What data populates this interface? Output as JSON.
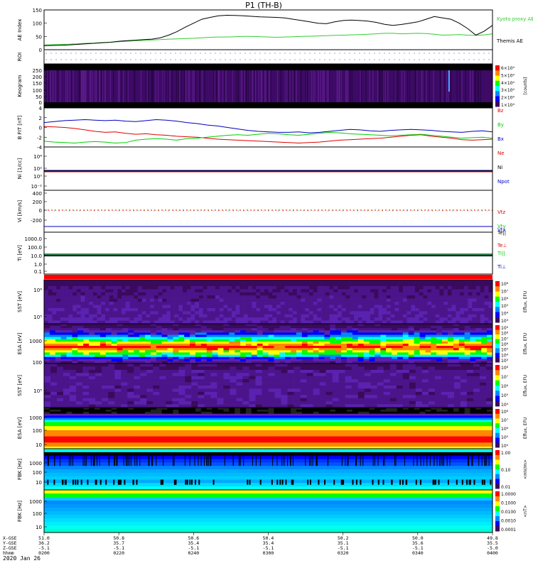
{
  "title": "P1 (TH-B)",
  "date_label": "2020 Jan 26",
  "colors": {
    "black": "#000000",
    "red": "#e00000",
    "green": "#00d000",
    "blue": "#0000c0",
    "kyoto": "#33cc33",
    "spec_bg": "#3a0a5c"
  },
  "chart_data": [
    {
      "id": "ae",
      "type": "line",
      "ylabel": "AE Index",
      "ylim": [
        0,
        150
      ],
      "yticks": [
        "0",
        "50",
        "100",
        "150"
      ],
      "series": [
        {
          "name": "Kyoto proxy AE",
          "color": "#33cc33",
          "values": [
            18,
            19,
            20,
            21,
            22,
            24,
            25,
            27,
            28,
            30,
            32,
            34,
            35,
            37,
            38,
            40,
            41,
            42,
            43,
            45,
            47,
            48,
            48,
            49,
            50,
            50,
            49,
            48,
            47,
            48,
            49,
            50,
            51,
            52,
            53,
            54,
            55,
            56,
            57,
            58,
            60,
            62,
            62,
            60,
            61,
            62,
            61,
            58,
            55,
            56,
            57,
            55,
            54,
            56,
            60
          ]
        },
        {
          "name": "Themis AE",
          "color": "#000000",
          "values": [
            15,
            16,
            17,
            18,
            20,
            22,
            24,
            26,
            28,
            32,
            34,
            36,
            38,
            40,
            45,
            55,
            68,
            85,
            100,
            115,
            122,
            128,
            130,
            129,
            128,
            126,
            124,
            123,
            122,
            120,
            115,
            110,
            105,
            100,
            98,
            105,
            110,
            112,
            110,
            108,
            103,
            96,
            92,
            95,
            100,
            105,
            115,
            125,
            120,
            115,
            100,
            80,
            55,
            70,
            92
          ]
        }
      ]
    },
    {
      "id": "roi",
      "type": "line",
      "ylabel": "ROI"
    },
    {
      "id": "keogram",
      "type": "heatmap",
      "ylabel": "Keogram",
      "yticks": [
        "0",
        "50",
        "100",
        "150",
        "200",
        "250"
      ],
      "colorbar": {
        "label": "[counts]",
        "ticks": [
          "6×10⁴",
          "5×10⁴",
          "4×10⁴",
          "3×10⁴",
          "2×10⁴",
          "1×10⁴"
        ]
      }
    },
    {
      "id": "bfield",
      "type": "line",
      "ylabel": "B FIT [nT]",
      "ylim": [
        -4,
        4
      ],
      "yticks": [
        "4",
        "2",
        "0",
        "-2",
        "-4"
      ],
      "series": [
        {
          "name": "Bz",
          "color": "#e00000",
          "values": [
            0.2,
            0.1,
            0.0,
            -0.2,
            -0.5,
            -0.8,
            -1.0,
            -0.9,
            -1.2,
            -1.4,
            -1.3,
            -1.5,
            -1.6,
            -1.8,
            -1.9,
            -2.0,
            -2.2,
            -2.4,
            -2.5,
            -2.6,
            -2.7,
            -2.8,
            -2.9,
            -3.0,
            -3.1,
            -3.2,
            -3.1,
            -3.0,
            -2.8,
            -2.6,
            -2.5,
            -2.4,
            -2.3,
            -2.2,
            -2.0,
            -1.8,
            -1.6,
            -1.5,
            -1.8,
            -2.0,
            -2.2,
            -2.5,
            -2.6,
            -2.5,
            -2.4
          ]
        },
        {
          "name": "By",
          "color": "#00d000",
          "values": [
            -2.8,
            -3.0,
            -3.1,
            -3.2,
            -3.0,
            -2.9,
            -3.0,
            -3.2,
            -3.1,
            -2.6,
            -2.4,
            -2.3,
            -2.4,
            -2.6,
            -2.3,
            -2.2,
            -2.0,
            -1.8,
            -1.6,
            -1.5,
            -1.6,
            -1.4,
            -1.2,
            -1.3,
            -1.5,
            -1.6,
            -1.4,
            -1.2,
            -1.0,
            -1.1,
            -1.3,
            -1.4,
            -1.5,
            -1.6,
            -1.7,
            -1.6,
            -1.5,
            -1.4,
            -1.6,
            -1.8,
            -2.0,
            -2.2,
            -2.1,
            -2.0,
            -2.2
          ]
        },
        {
          "name": "Bx",
          "color": "#0000c0",
          "values": [
            1.0,
            1.2,
            1.4,
            1.5,
            1.6,
            1.5,
            1.4,
            1.5,
            1.3,
            1.2,
            1.4,
            1.6,
            1.5,
            1.3,
            1.0,
            0.8,
            0.5,
            0.3,
            0.0,
            -0.3,
            -0.6,
            -0.8,
            -0.9,
            -1.0,
            -1.0,
            -0.9,
            -1.1,
            -1.0,
            -0.8,
            -0.6,
            -0.4,
            -0.5,
            -0.7,
            -0.8,
            -0.6,
            -0.5,
            -0.4,
            -0.5,
            -0.6,
            -0.8,
            -0.9,
            -1.0,
            -0.8,
            -0.7,
            -0.9
          ]
        }
      ]
    },
    {
      "id": "density",
      "type": "line",
      "ylabel": "Ni [1/cc]",
      "yticks": [
        "10⁴",
        "10²",
        "10⁰",
        "10⁻²"
      ],
      "series": [
        {
          "name": "Ne",
          "color": "#e00000"
        },
        {
          "name": "Ni",
          "color": "#000000"
        },
        {
          "name": "Npot",
          "color": "#0000c0"
        }
      ]
    },
    {
      "id": "velocity",
      "type": "line",
      "ylabel": "Vi [km/s]",
      "yticks": [
        "400",
        "200",
        "0",
        "-200"
      ],
      "series": [
        {
          "name": "Vtz",
          "color": "#e00000"
        },
        {
          "name": "Vty",
          "color": "#00d000"
        },
        {
          "name": "Vtx",
          "color": "#0000c0"
        }
      ]
    },
    {
      "id": "temperature",
      "type": "line",
      "ylabel": "Ti [eV]",
      "yticks": [
        "1000.0",
        "100.0",
        "10.0",
        "1.0",
        "0.1"
      ],
      "series": [
        {
          "name": "Te||",
          "color": "#000000"
        },
        {
          "name": "Te⊥",
          "color": "#e00000"
        },
        {
          "name": "Ti||",
          "color": "#00d000"
        },
        {
          "name": "Ti⊥",
          "color": "#0000c0"
        }
      ]
    },
    {
      "id": "sst_e",
      "type": "heatmap",
      "ylabel": "SST [eV]",
      "yticks": [
        "10⁶",
        "10⁵"
      ],
      "colorbar": {
        "label": "Eflux, EFU",
        "ticks": [
          "10⁸",
          "10⁷",
          "10⁶",
          "10⁵",
          "10⁴",
          "10³"
        ]
      }
    },
    {
      "id": "esa_e",
      "type": "heatmap",
      "ylabel": "ESA [eV]",
      "yticks": [
        "1000",
        "100"
      ],
      "colorbar": {
        "label": "Eflux, EFU",
        "ticks": [
          "10⁹",
          "10⁸",
          "10⁷",
          "10⁶",
          "10⁵",
          "10⁴",
          "10³"
        ]
      }
    },
    {
      "id": "sst_i",
      "type": "heatmap",
      "ylabel": "SST [eV]",
      "yticks": [
        "10⁵"
      ],
      "colorbar": {
        "label": "Eflux, EFU",
        "ticks": [
          "10⁸",
          "10⁷",
          "10⁶",
          "10⁵",
          "10⁴"
        ]
      }
    },
    {
      "id": "esa_i",
      "type": "heatmap",
      "ylabel": "ESA [eV]",
      "yticks": [
        "1000",
        "100",
        "10"
      ],
      "colorbar": {
        "label": "Eflux, EFU",
        "ticks": [
          "10⁸",
          "10⁷",
          "10⁶",
          "10⁵",
          "10⁴"
        ]
      }
    },
    {
      "id": "fbk_e",
      "type": "heatmap",
      "ylabel": "FBK [Hz]",
      "yticks": [
        "1000",
        "100",
        "10"
      ],
      "colorbar": {
        "label": "<mV/m>",
        "ticks": [
          "1.00",
          "0.10",
          "0.01"
        ]
      }
    },
    {
      "id": "fbk_b",
      "type": "heatmap",
      "ylabel": "FBK [Hz]",
      "yticks": [
        "1000",
        "100",
        "10"
      ],
      "colorbar": {
        "label": "<nT>",
        "ticks": [
          "1.0000",
          "0.1000",
          "0.0100",
          "0.0010",
          "0.0001"
        ]
      }
    }
  ],
  "xaxis": {
    "row_labels": [
      "X-GSE",
      "Y-GSE",
      "Z-GSE",
      "hhmm"
    ],
    "columns": [
      {
        "x": "51.0",
        "y": "36.2",
        "z": "-5.1",
        "t": "0200"
      },
      {
        "x": "50.8",
        "y": "35.7",
        "z": "-5.1",
        "t": "0220"
      },
      {
        "x": "50.6",
        "y": "35.4",
        "z": "-5.1",
        "t": "0240"
      },
      {
        "x": "50.4",
        "y": "35.4",
        "z": "-5.1",
        "t": "0300"
      },
      {
        "x": "50.2",
        "y": "35.1",
        "z": "-5.1",
        "t": "0320"
      },
      {
        "x": "50.0",
        "y": "35.6",
        "z": "-5.1",
        "t": "0340"
      },
      {
        "x": "49.8",
        "y": "35.5",
        "z": "-5.0",
        "t": "0400"
      }
    ]
  }
}
